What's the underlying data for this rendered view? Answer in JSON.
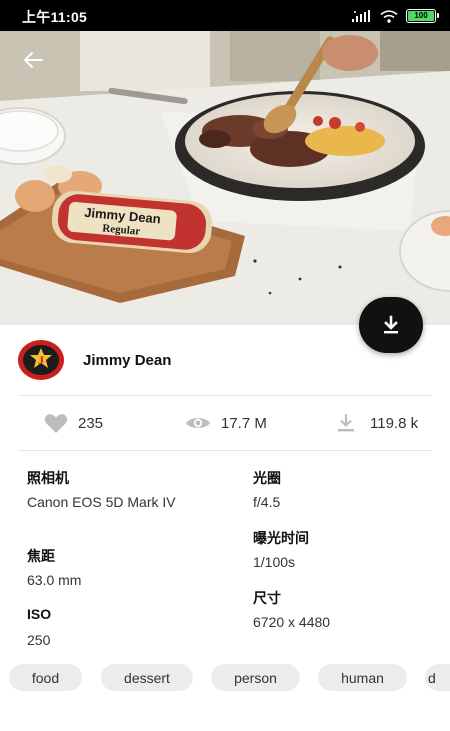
{
  "status_bar": {
    "time": "上午11:05",
    "battery": "100"
  },
  "author": {
    "name": "Jimmy Dean",
    "avatar_letter": "J"
  },
  "stats": {
    "likes": "235",
    "views": "17.7 M",
    "downloads": "119.8 k"
  },
  "exif": {
    "camera_label": "照相机",
    "camera_value": "Canon EOS 5D Mark IV",
    "aperture_label": "光圈",
    "aperture_value": "f/4.5",
    "focal_label": "焦距",
    "focal_value": "63.0 mm",
    "exposure_label": "曝光时间",
    "exposure_value": "1/100s",
    "iso_label": "ISO",
    "iso_value": "250",
    "size_label": "尺寸",
    "size_value": "6720 x 4480"
  },
  "tags": [
    "food",
    "dessert",
    "person",
    "human",
    "d"
  ],
  "hero": {
    "package_brand": "Jimmy Dean",
    "package_variant": "Regular"
  }
}
